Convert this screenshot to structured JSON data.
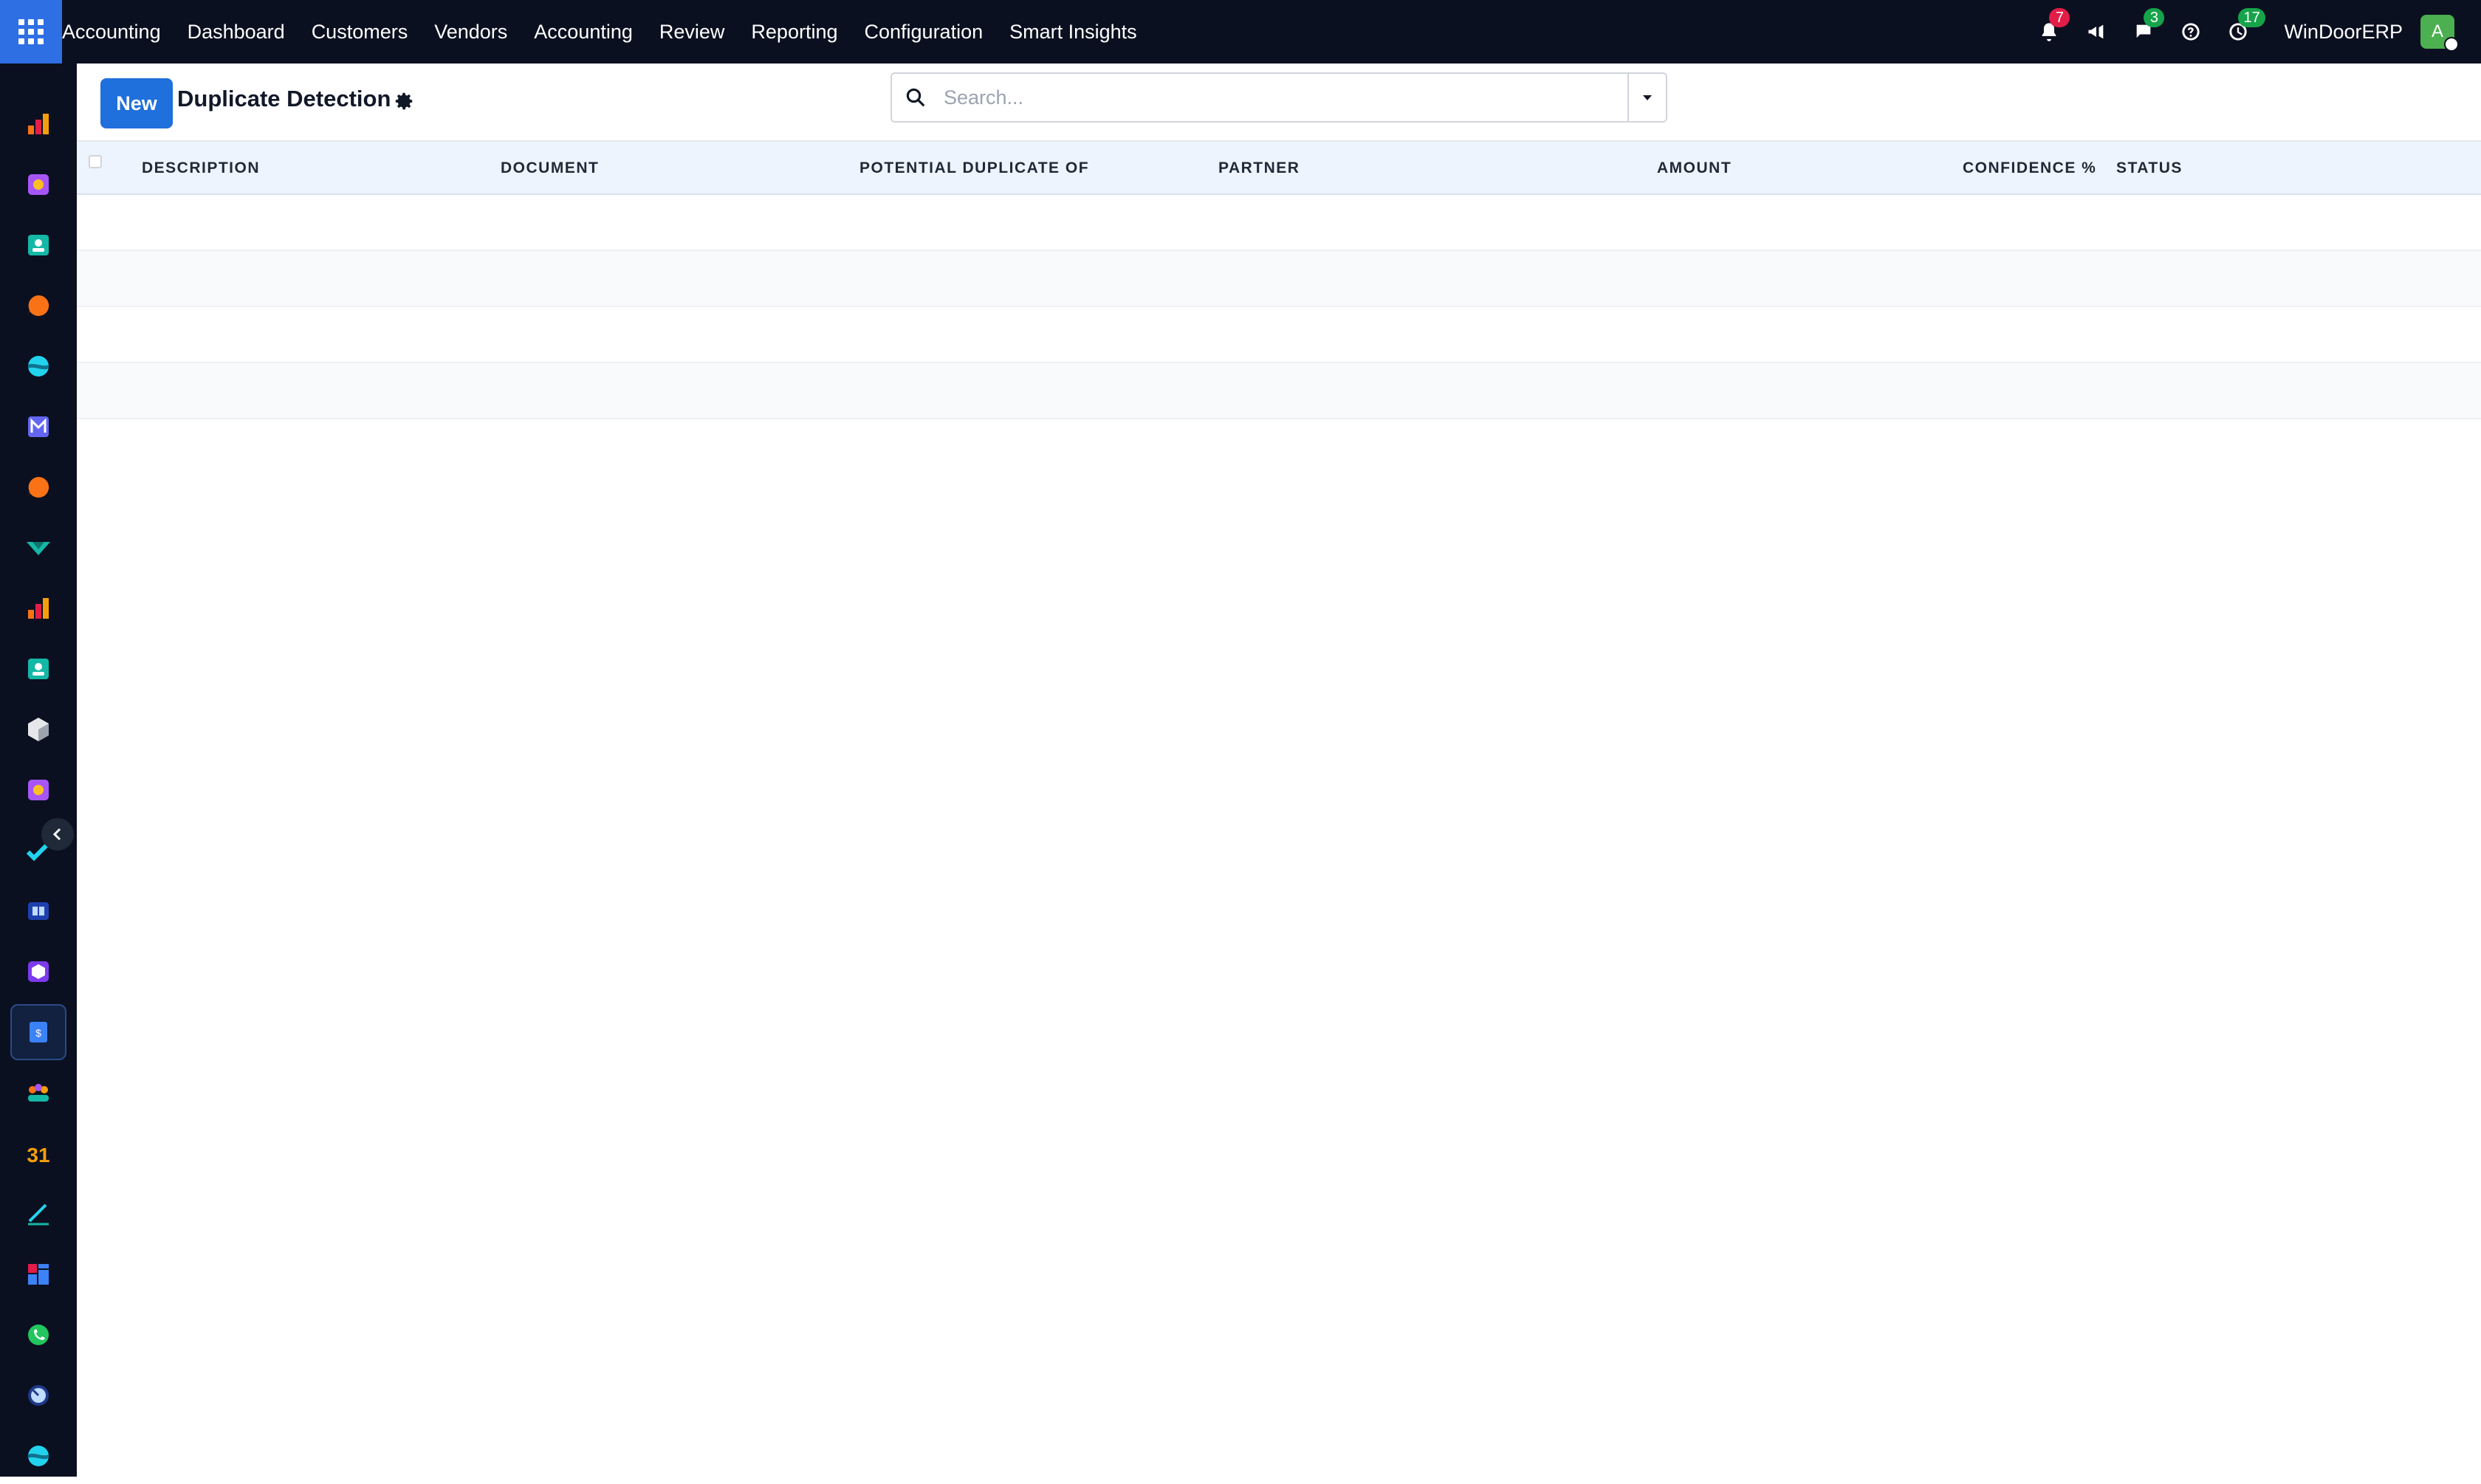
{
  "topbar": {
    "brand": "Accounting",
    "menu": [
      "Dashboard",
      "Customers",
      "Vendors",
      "Accounting",
      "Review",
      "Reporting",
      "Configuration",
      "Smart Insights"
    ],
    "notifications_count": "7",
    "messages_count": "3",
    "activities_count": "17",
    "company": "WinDoorERP",
    "avatar_letter": "A",
    "icons": [
      "apps-grid-icon",
      "bell-icon",
      "megaphone-icon",
      "chat-icon",
      "help-icon",
      "clock-icon"
    ]
  },
  "sidebar": {
    "apps": [
      "accounting-chart-icon",
      "inventory-icon",
      "contacts-icon",
      "discuss-icon",
      "website-icon",
      "email-marketing-icon",
      "livechat-icon",
      "project-icon",
      "reports-icon",
      "employees-icon",
      "product-icon",
      "sales-icon",
      "todo-icon",
      "knowledge-icon",
      "purchase-icon",
      "invoicing-icon",
      "team-icon",
      "calendar-icon",
      "sign-icon",
      "dashboards-icon",
      "whatsapp-icon",
      "timesheet-icon",
      "website-builder-icon"
    ],
    "active_app": "invoicing-icon",
    "calendar_glyph": "31"
  },
  "control_panel": {
    "new_label": "New",
    "title": "Duplicate Detection",
    "search_placeholder": "Search..."
  },
  "table": {
    "columns": [
      "DESCRIPTION",
      "DOCUMENT",
      "POTENTIAL DUPLICATE OF",
      "PARTNER",
      "AMOUNT",
      "CONFIDENCE %",
      "STATUS"
    ],
    "rows": []
  },
  "colors": {
    "topbar_bg": "#0b1020",
    "primary": "#1f6fdc",
    "header_bg": "#eef4fd"
  }
}
